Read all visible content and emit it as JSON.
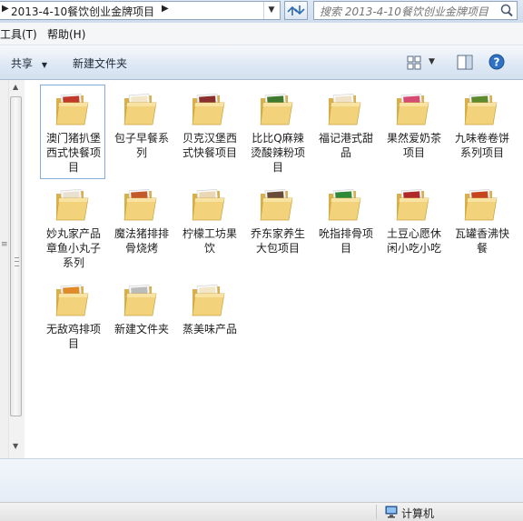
{
  "address": {
    "path": "2013-4-10餐饮创业金牌项目",
    "dropdown_icon": "chevron-down-icon"
  },
  "search": {
    "placeholder": "搜索 2013-4-10餐饮创业金牌项目",
    "icon": "search-icon"
  },
  "menu": {
    "items": [
      "工具(T)",
      "帮助(H)"
    ]
  },
  "toolbar": {
    "share_label": "共享",
    "new_folder_label": "新建文件夹"
  },
  "folders": [
    {
      "name": "澳门猪扒堡西式快餐项目",
      "selected": true,
      "colors": [
        "#c0392b",
        "#e8a33a"
      ]
    },
    {
      "name": "包子早餐系列",
      "selected": false,
      "colors": [
        "#f3e7c9",
        "#d2a35a"
      ]
    },
    {
      "name": "贝克汉堡西式快餐项目",
      "selected": false,
      "colors": [
        "#8b2e2e",
        "#e0b04a"
      ]
    },
    {
      "name": "比比Q麻辣烫酸辣粉项目",
      "selected": false,
      "colors": [
        "#3f7a2e",
        "#e7c24a"
      ]
    },
    {
      "name": "福记港式甜品",
      "selected": false,
      "colors": [
        "#f0e2c8",
        "#c88b4a"
      ]
    },
    {
      "name": "果然爱奶茶项目",
      "selected": false,
      "colors": [
        "#d64b72",
        "#f2b6c6"
      ]
    },
    {
      "name": "九味卷卷饼系列项目",
      "selected": false,
      "colors": [
        "#5e8a2f",
        "#f0c85a"
      ]
    },
    {
      "name": "妙丸家产品章鱼小丸子系列",
      "selected": false,
      "colors": [
        "#e9e1cf",
        "#b7a37a"
      ]
    },
    {
      "name": "魔法猪排排骨烧烤",
      "selected": false,
      "colors": [
        "#c35a2a",
        "#f0d38a"
      ]
    },
    {
      "name": "柠檬工坊果饮",
      "selected": false,
      "colors": [
        "#ead7b5",
        "#b9884f"
      ]
    },
    {
      "name": "乔东家养生大包项目",
      "selected": false,
      "colors": [
        "#6a4a3a",
        "#d6a56a"
      ]
    },
    {
      "name": "吮指排骨项目",
      "selected": false,
      "colors": [
        "#2f8a3a",
        "#e9d25a"
      ]
    },
    {
      "name": "土豆心愿休闲小吃小吃",
      "selected": false,
      "colors": [
        "#b02a2a",
        "#f2c04a"
      ]
    },
    {
      "name": "瓦罐香沸快餐",
      "selected": false,
      "colors": [
        "#c8441e",
        "#f0b84a"
      ]
    },
    {
      "name": "无敌鸡排项目",
      "selected": false,
      "colors": [
        "#e08a2a",
        "#f6d36a"
      ]
    },
    {
      "name": "新建文件夹",
      "selected": false,
      "colors": [
        "#bcbcbc",
        "#dedede"
      ]
    },
    {
      "name": "蒸美味产品",
      "selected": false,
      "colors": [
        "#f3e6c6",
        "#e6c98a"
      ]
    }
  ],
  "status": {
    "computer_label": "计算机"
  }
}
